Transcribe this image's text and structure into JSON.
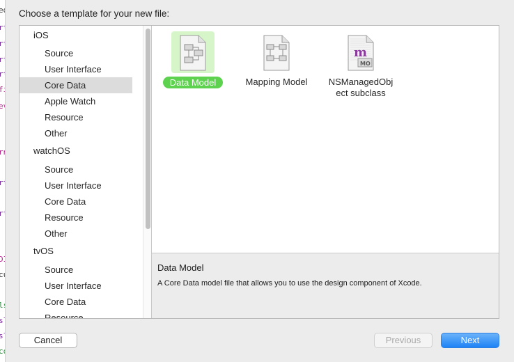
{
  "background_code": {
    "glyphs": [
      "ed",
      "rt",
      "rt",
      "rt",
      "rt",
      "fi",
      "ev",
      "rn",
      "rt",
      "rt",
      "DI",
      "cu",
      "ls",
      "sl",
      "sl",
      "co"
    ]
  },
  "dialog": {
    "title": "Choose a template for your new file:"
  },
  "sidebar": {
    "platforms": [
      {
        "name": "iOS",
        "categories": [
          "Source",
          "User Interface",
          "Core Data",
          "Apple Watch",
          "Resource",
          "Other"
        ]
      },
      {
        "name": "watchOS",
        "categories": [
          "Source",
          "User Interface",
          "Core Data",
          "Resource",
          "Other"
        ]
      },
      {
        "name": "tvOS",
        "categories": [
          "Source",
          "User Interface",
          "Core Data",
          "Resource"
        ]
      }
    ],
    "selected": "iOS / Core Data"
  },
  "templates": [
    {
      "label": "Data Model",
      "icon": "data-model-icon",
      "selected": true
    },
    {
      "label": "Mapping Model",
      "icon": "mapping-model-icon",
      "selected": false
    },
    {
      "label": "NSManagedObject subclass",
      "label_lines": [
        "NSManagedObj",
        "ect subclass"
      ],
      "icon": "managed-object-icon",
      "selected": false
    }
  ],
  "description": {
    "title": "Data Model",
    "body": "A Core Data model file that allows you to use the design component of Xcode."
  },
  "buttons": {
    "cancel": "Cancel",
    "previous": "Previous",
    "next": "Next"
  },
  "colors": {
    "selection_green": "#5dd24f",
    "selection_bg": "#d6f5c8",
    "accent_blue": "#1d82f5",
    "sidebar_selected": "#dcdcdc"
  }
}
